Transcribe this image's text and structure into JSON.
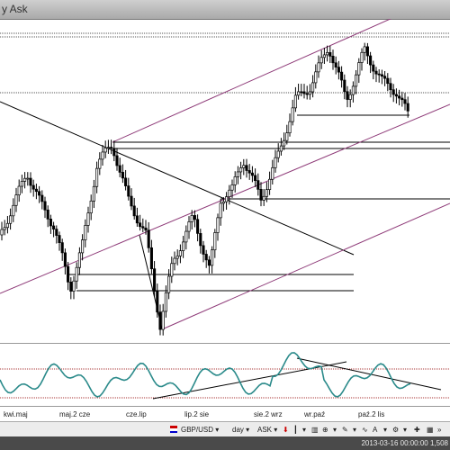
{
  "window": {
    "title": "y Ask"
  },
  "xaxis": {
    "labels": [
      "kwi.maj",
      "maj.2 cze",
      "cze.lip",
      "lip.2 sie",
      "sie.2 wrz",
      "wr.paź",
      "paź.2 lis"
    ]
  },
  "toolbar": {
    "symbol": "GBP/USD",
    "period": "day",
    "price_type": "ASK"
  },
  "statusbar": {
    "text": "2013-03-16 00:00:00  1,508"
  },
  "colors": {
    "channel": "#8e3a78",
    "oscillator": "#2a8a8a",
    "candles": "#000000"
  }
}
